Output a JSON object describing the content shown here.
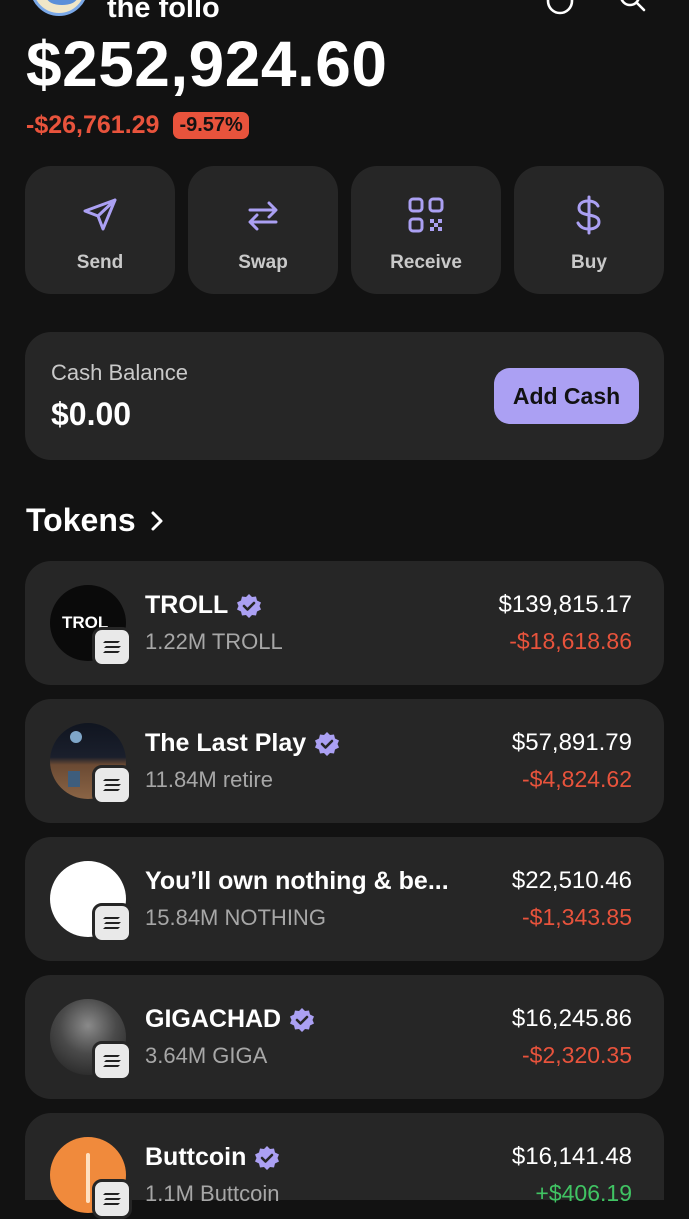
{
  "header": {
    "wallet_name": "the follo",
    "balance": "$252,924.60",
    "change_amount": "-$26,761.29",
    "change_percent": "-9.57%"
  },
  "actions": [
    {
      "label": "Send",
      "icon": "send-icon"
    },
    {
      "label": "Swap",
      "icon": "swap-icon"
    },
    {
      "label": "Receive",
      "icon": "qr-code-icon"
    },
    {
      "label": "Buy",
      "icon": "dollar-icon"
    }
  ],
  "cash": {
    "label": "Cash Balance",
    "value": "$0.00",
    "button": "Add Cash"
  },
  "tokens_section": {
    "title": "Tokens"
  },
  "tokens": [
    {
      "name": "TROLL",
      "amount": "1.22M TROLL",
      "value": "$139,815.17",
      "change": "-$18,618.86",
      "verified": true,
      "avatar_text": "TROL"
    },
    {
      "name": "The Last Play",
      "amount": "11.84M retire",
      "value": "$57,891.79",
      "change": "-$4,824.62",
      "verified": true
    },
    {
      "name": "You’ll own nothing & be...",
      "amount": "15.84M NOTHING",
      "value": "$22,510.46",
      "change": "-$1,343.85",
      "verified": false
    },
    {
      "name": "GIGACHAD",
      "amount": "3.64M GIGA",
      "value": "$16,245.86",
      "change": "-$2,320.35",
      "verified": true
    },
    {
      "name": "Buttcoin",
      "amount": "1.1M Buttcoin",
      "value": "$16,141.48",
      "change": "+$406.19",
      "verified": true
    }
  ],
  "colors": {
    "background": "#121212",
    "card": "#262626",
    "accent": "#aba0f3",
    "negative": "#e8533c",
    "positive": "#40c463"
  }
}
